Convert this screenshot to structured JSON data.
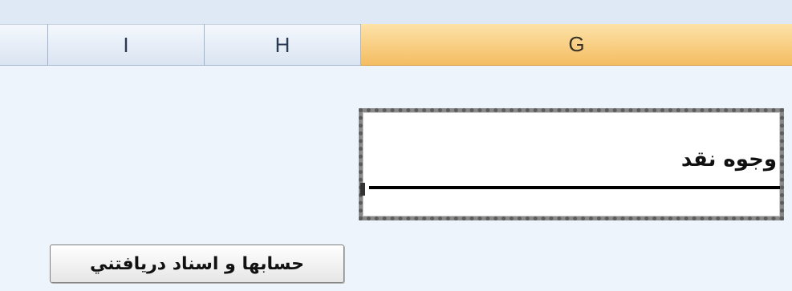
{
  "column_headers": [
    {
      "label": "I",
      "selected": false
    },
    {
      "label": "H",
      "selected": false
    },
    {
      "label": "G",
      "selected": true
    }
  ],
  "cell": {
    "text": "وجوه نقد"
  },
  "button": {
    "label": "حسابها و اسناد دريافتني"
  },
  "colors": {
    "selected_header": "#f4bd62",
    "header_bg": "#dae4f1",
    "sheet_bg": "#eef4fb"
  }
}
